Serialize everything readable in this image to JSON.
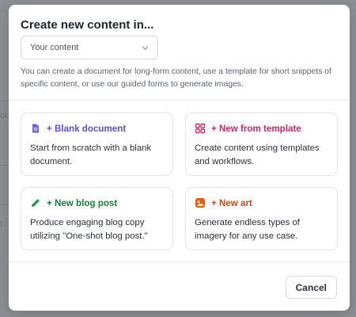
{
  "background": {
    "fragment_1": "ou",
    "fragment_2": "t"
  },
  "modal": {
    "title": "Create new content in...",
    "select": {
      "value": "Your content"
    },
    "description": "You can create a document for long-form content, use a template for short snippets of specific content, or use our guided forms to generate images.",
    "cards": [
      {
        "title": "+ Blank document",
        "description": "Start from scratch with a blank document.",
        "icon": "document-icon",
        "color": "#5b4fd6"
      },
      {
        "title": "+ New from template",
        "description": "Create content using templates and workflows.",
        "icon": "template-grid-icon",
        "color": "#d1246b"
      },
      {
        "title": "+ New blog post",
        "description": "Produce engaging blog copy utilizing \"One-shot blog post.\"",
        "icon": "pen-icon",
        "color": "#15803d"
      },
      {
        "title": "+ New art",
        "description": "Generate endless types of imagery for any use case.",
        "icon": "art-icon",
        "color": "#d9480f"
      }
    ],
    "cancel_label": "Cancel"
  }
}
